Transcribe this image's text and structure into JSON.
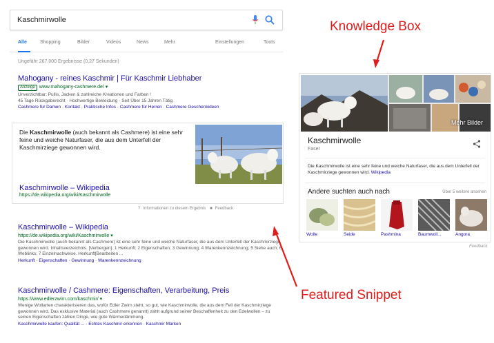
{
  "search": {
    "query": "Kaschmirwolle"
  },
  "tabs": [
    {
      "label": "Alle"
    },
    {
      "label": "Shopping"
    },
    {
      "label": "Bilder"
    },
    {
      "label": "Videos"
    },
    {
      "label": "News"
    },
    {
      "label": "Mehr"
    },
    {
      "label": "Einstellungen"
    },
    {
      "label": "Tools"
    }
  ],
  "stats": "Ungefähr 267.000 Ergebnisse (0,27 Sekunden)",
  "ad": {
    "title": "Mahogany - reines Kaschmir | Für Kaschmir Liebhaber",
    "badge": "Anzeige",
    "url": "www.mahogany-cashmere.de/",
    "desc1": "Unverzichtbar: Pullis, Jacken & zahlreiche Kreationen und Farben !",
    "desc2": "45 Tage Rückgaberecht · Hochwertige Bekleidung · Seit Über 15 Jahren Tätig",
    "links": "Cashmere für Damen · Kontakt · Praktische Infos · Cashmere für Herren · Cashmere Geschenkideen"
  },
  "snippet": {
    "text_pre": "Die ",
    "text_bold": "Kaschmirwolle",
    "text_post": " (auch bekannt als Cashmere) ist eine sehr feine und weiche Naturfaser, die aus dem Unterfell der Kaschmirziege gewonnen wird.",
    "title": "Kaschmirwolle – Wikipedia",
    "url": "https://de.wikipedia.org/wiki/Kaschmirwolle",
    "info": "Informationen zu diesem Ergebnis",
    "feedback": "Feedback"
  },
  "result1": {
    "title": "Kaschmirwolle – Wikipedia",
    "url": "https://de.wikipedia.org/wiki/Kaschmirwolle",
    "desc": "Die Kaschmirwolle (auch bekannt als Cashmere) ist eine sehr feine und weiche Naturfaser, die aus dem Unterfell der Kaschmirziege gewonnen wird. Inhaltsverzeichnis. [Verbergen]. 1 Herkunft; 2 Eigenschaften; 3 Gewinnung; 4 Warenkennzeichnung; 5 Siehe auch; 6 Weblinks; 7 Einzelnachweise. Herkunft[Bearbeiten ...",
    "links": "Herkunft · Eigenschaften · Gewinnung · Warenkennzeichnung"
  },
  "result2": {
    "title": "Kaschmirwolle / Cashmere: Eigenschaften, Verarbeitung, Preis",
    "url": "https://www.edlerzwirn.com/kaschmir/",
    "desc": "Wenige Wollarten charakterisieren das, wofür Edler Zwirn steht, so gut, wie Kaschmirwolle, die aus dem Fell der Kaschmirziege gewonnen wird. Das exklusive Material (auch Cashmere genannt) zählt aufgrund seiner Beschaffenheit zu den Edelwollen – zu seinen Eigenschaften zählen Dinge, wie gute Wärmedämmung.",
    "links": "Kaschmirwolle kaufen: Qualität ... · Echtes Kaschmir erkennen · Kaschmir Marken"
  },
  "knowledge": {
    "more_images": "Mehr Bilder",
    "title": "Kaschmirwolle",
    "subtitle": "Faser",
    "desc": "Die Kaschmirwolle ist eine sehr feine und weiche Naturfaser, die aus dem Unterfell der Kaschmirziege gewonnen wird.",
    "desc_link": "Wikipedia",
    "related_title": "Andere suchten auch nach",
    "related_more": "Über 5 weitere ansehen",
    "related": [
      {
        "label": "Wolle"
      },
      {
        "label": "Seide"
      },
      {
        "label": "Pashmina"
      },
      {
        "label": "Baumwoll..."
      },
      {
        "label": "Angora"
      }
    ],
    "feedback": "Feedback"
  },
  "annotations": {
    "knowledge_box": "Knowledge Box",
    "featured_snippet": "Featured Snippet"
  },
  "colors": {
    "link": "#1a0dab",
    "url": "#006621",
    "accent": "#1a73e8",
    "annotation": "#e01b1b"
  }
}
